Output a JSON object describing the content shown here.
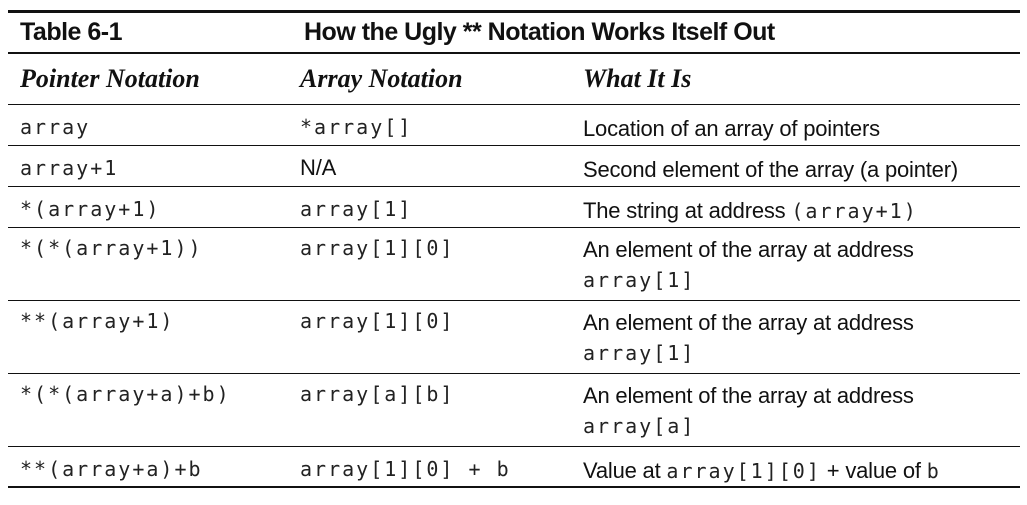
{
  "table": {
    "number": "Table 6-1",
    "title": "How the Ugly ** Notation Works Itself Out",
    "headers": {
      "pointer": "Pointer Notation",
      "array": "Array Notation",
      "what": "What It Is"
    },
    "rows": [
      {
        "pointer": "array",
        "array": "*array[]",
        "array_is_code": true,
        "desc1": [
          {
            "t": "Location of an array of pointers",
            "code": false
          }
        ],
        "desc2": []
      },
      {
        "pointer": "array+1",
        "array": "N/A",
        "array_is_code": false,
        "desc1": [
          {
            "t": "Second element of the array (a pointer)",
            "code": false
          }
        ],
        "desc2": []
      },
      {
        "pointer": "*(array+1)",
        "array": "array[1]",
        "array_is_code": true,
        "desc1": [
          {
            "t": "The string at address ",
            "code": false
          },
          {
            "t": "(array+1)",
            "code": true
          }
        ],
        "desc2": []
      },
      {
        "pointer": "*(*(array+1))",
        "array": "array[1][0]",
        "array_is_code": true,
        "desc1": [
          {
            "t": "An element of the array at address",
            "code": false
          }
        ],
        "desc2": [
          {
            "t": "array[1]",
            "code": true
          }
        ]
      },
      {
        "pointer": "**(array+1)",
        "array": "array[1][0]",
        "array_is_code": true,
        "desc1": [
          {
            "t": "An element of the array at address",
            "code": false
          }
        ],
        "desc2": [
          {
            "t": "array[1]",
            "code": true
          }
        ]
      },
      {
        "pointer": "*(*(array+a)+b)",
        "array": "array[a][b]",
        "array_is_code": true,
        "desc1": [
          {
            "t": "An element of the array at address",
            "code": false
          }
        ],
        "desc2": [
          {
            "t": "array[a]",
            "code": true
          }
        ]
      },
      {
        "pointer": "**(array+a)+b",
        "array": "array[1][0] + b",
        "array_is_code": true,
        "desc1": [
          {
            "t": "Value at ",
            "code": false
          },
          {
            "t": "array[1][0]",
            "code": true
          },
          {
            "t": " + value of ",
            "code": false
          },
          {
            "t": "b",
            "code": true
          }
        ],
        "desc2": []
      }
    ]
  }
}
